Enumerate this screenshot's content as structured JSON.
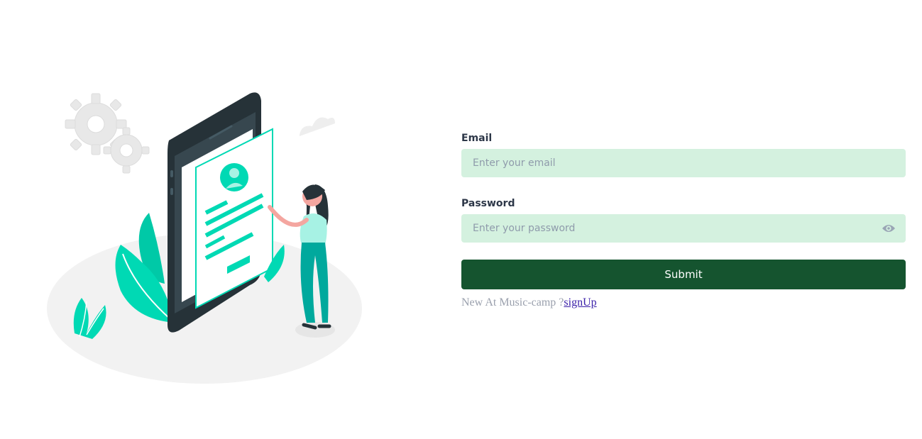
{
  "form": {
    "email_label": "Email",
    "email_placeholder": "Enter your email",
    "email_value": "",
    "password_label": "Password",
    "password_placeholder": "Enter your password",
    "password_value": "",
    "submit_label": "Submit",
    "signup_text": "New At Music-camp ?",
    "signup_link": "signUp"
  },
  "icons": {
    "password_toggle": "eye-icon"
  },
  "colors": {
    "input_bg": "#d4f1df",
    "button_bg": "#15542f",
    "accent": "#00d9b4",
    "phone": "#263238"
  }
}
